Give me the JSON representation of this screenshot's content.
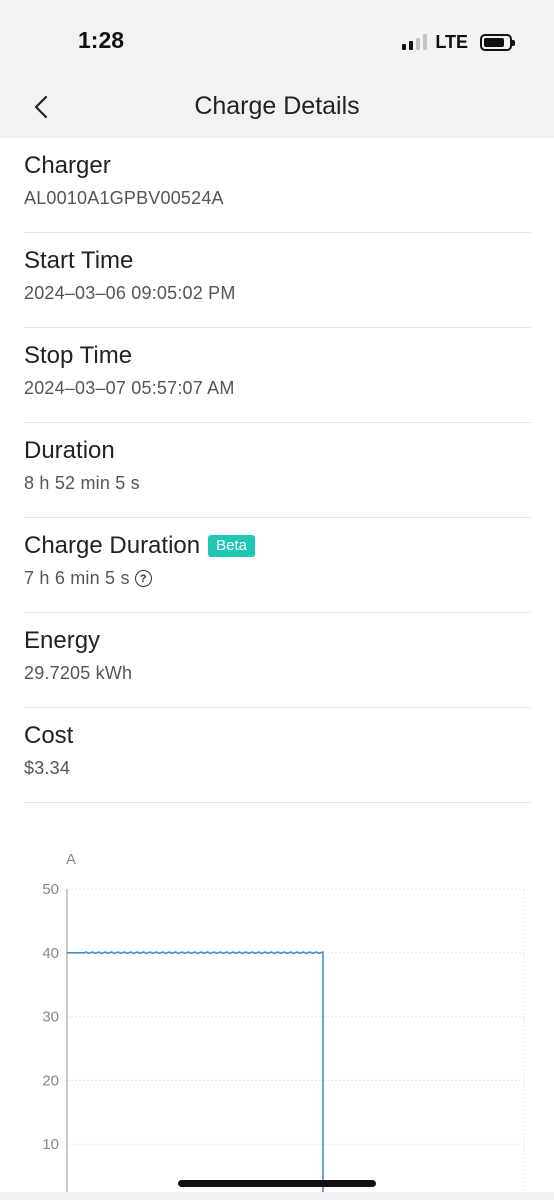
{
  "status": {
    "time": "1:28",
    "network": "LTE"
  },
  "nav": {
    "title": "Charge Details"
  },
  "details": [
    {
      "label": "Charger",
      "value": "AL0010A1GPBV00524A"
    },
    {
      "label": "Start Time",
      "value": "2024–03–06 09:05:02 PM"
    },
    {
      "label": "Stop Time",
      "value": "2024–03–07 05:57:07 AM"
    },
    {
      "label": "Duration",
      "value": "8 h 52 min 5 s"
    },
    {
      "label": "Charge Duration",
      "badge": "Beta",
      "value": "7 h 6 min 5 s"
    },
    {
      "label": "Energy",
      "value": "29.7205 kWh"
    },
    {
      "label": "Cost",
      "value": "$3.34"
    }
  ],
  "chart_data": {
    "type": "line",
    "ylabel": "A",
    "yticks": [
      "50",
      "40",
      "30",
      "20",
      "10"
    ],
    "ylim": [
      0,
      50
    ],
    "grid": true,
    "series_color": "#3b8fd6",
    "series": [
      {
        "values_description_free": true,
        "x_fraction": [
          0.0,
          0.56,
          0.5601,
          0.5602
        ],
        "y": [
          40,
          40,
          40,
          0
        ]
      }
    ]
  },
  "colors": {
    "accent": "#1fc7b4",
    "line": "#3b8fd6"
  }
}
